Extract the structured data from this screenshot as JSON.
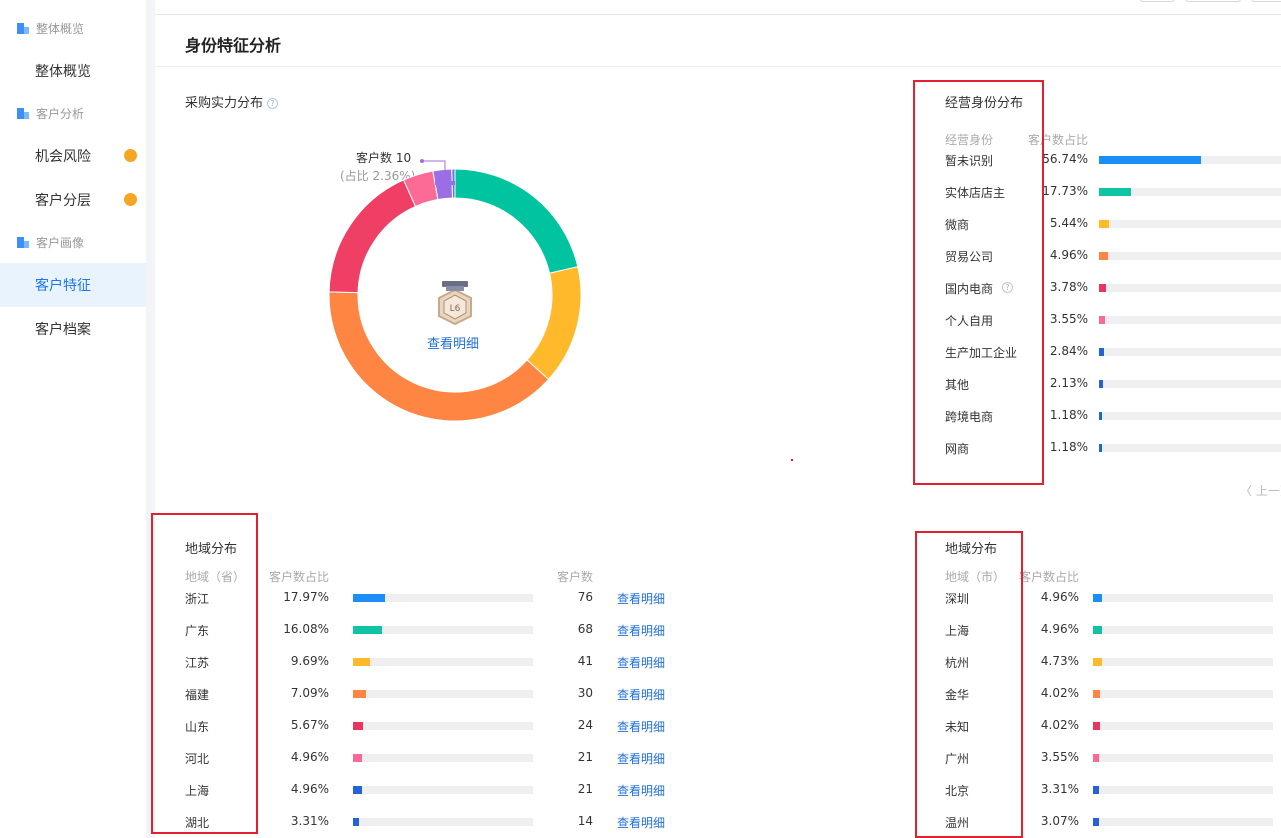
{
  "sidebar": {
    "groups": [
      {
        "label": "整体概览",
        "items": [
          {
            "label": "整体概览",
            "dot": false,
            "active": false
          }
        ]
      },
      {
        "label": "客户分析",
        "items": [
          {
            "label": "机会风险",
            "dot": true,
            "active": false
          },
          {
            "label": "客户分层",
            "dot": true,
            "active": false
          }
        ]
      },
      {
        "label": "客户画像",
        "items": [
          {
            "label": "客户特征",
            "dot": false,
            "active": true
          },
          {
            "label": "客户档案",
            "dot": false,
            "active": false
          }
        ]
      }
    ]
  },
  "page": {
    "title": "身份特征分析"
  },
  "purchase_power": {
    "title": "采购实力分布",
    "callout_count": "客户数 10",
    "callout_ratio": "(占比 2.36%)",
    "level_badge": "L6",
    "view_detail": "查看明细"
  },
  "chart_data": {
    "type": "pie",
    "title": "采购实力分布",
    "slices": [
      {
        "value": 21.0,
        "color": "#00c4a0"
      },
      {
        "value": 15.0,
        "color": "#ffb92a"
      },
      {
        "value": 38.0,
        "color": "#ff8543"
      },
      {
        "value": 17.6,
        "color": "#f03f64"
      },
      {
        "value": 3.8,
        "color": "#fc6a96"
      },
      {
        "value": 2.36,
        "color": "#9b6ee6"
      },
      {
        "value": 0.4,
        "color": "#5b7fdb"
      }
    ],
    "legend": "none"
  },
  "business_identity": {
    "title": "经营身份分布",
    "col_name": "经营身份",
    "col_pct": "客户数占比",
    "rows": [
      {
        "name": "暂未识别",
        "pct": "56.74%",
        "ratio": 0.5674,
        "color": "#1b8ef7",
        "help": false
      },
      {
        "name": "实体店店主",
        "pct": "17.73%",
        "ratio": 0.1773,
        "color": "#0ec4a2",
        "help": false
      },
      {
        "name": "微商",
        "pct": "5.44%",
        "ratio": 0.0544,
        "color": "#ffb92a",
        "help": false
      },
      {
        "name": "贸易公司",
        "pct": "4.96%",
        "ratio": 0.0496,
        "color": "#ff8543",
        "help": false
      },
      {
        "name": "国内电商",
        "pct": "3.78%",
        "ratio": 0.0378,
        "color": "#e8375b",
        "help": true
      },
      {
        "name": "个人自用",
        "pct": "3.55%",
        "ratio": 0.0355,
        "color": "#f86a96",
        "help": false
      },
      {
        "name": "生产加工企业",
        "pct": "2.84%",
        "ratio": 0.0284,
        "color": "#2264d6",
        "help": false
      },
      {
        "name": "其他",
        "pct": "2.13%",
        "ratio": 0.0213,
        "color": "#2264d6",
        "help": false
      },
      {
        "name": "跨境电商",
        "pct": "1.18%",
        "ratio": 0.0118,
        "color": "#2264d6",
        "help": false
      },
      {
        "name": "网商",
        "pct": "1.18%",
        "ratio": 0.0118,
        "color": "#2264d6",
        "help": false
      }
    ],
    "pager_prev": "〈 上一页"
  },
  "region_province": {
    "title": "地域分布",
    "col_name": "地域（省）",
    "col_pct": "客户数占比",
    "col_count": "客户数",
    "rows": [
      {
        "name": "浙江",
        "pct": "17.97%",
        "ratio": 0.1797,
        "count": "76",
        "link": "查看明细",
        "color": "#1b8ef7"
      },
      {
        "name": "广东",
        "pct": "16.08%",
        "ratio": 0.1608,
        "count": "68",
        "link": "查看明细",
        "color": "#0ec4a2"
      },
      {
        "name": "江苏",
        "pct": "9.69%",
        "ratio": 0.0969,
        "count": "41",
        "link": "查看明细",
        "color": "#ffb92a"
      },
      {
        "name": "福建",
        "pct": "7.09%",
        "ratio": 0.0709,
        "count": "30",
        "link": "查看明细",
        "color": "#ff8543"
      },
      {
        "name": "山东",
        "pct": "5.67%",
        "ratio": 0.0567,
        "count": "24",
        "link": "查看明细",
        "color": "#e8375b"
      },
      {
        "name": "河北",
        "pct": "4.96%",
        "ratio": 0.0496,
        "count": "21",
        "link": "查看明细",
        "color": "#f86a96"
      },
      {
        "name": "上海",
        "pct": "4.96%",
        "ratio": 0.0496,
        "count": "21",
        "link": "查看明细",
        "color": "#2264d6"
      },
      {
        "name": "湖北",
        "pct": "3.31%",
        "ratio": 0.0331,
        "count": "14",
        "link": "查看明细",
        "color": "#2264d6"
      }
    ]
  },
  "region_city": {
    "title": "地域分布",
    "col_name": "地域（市）",
    "col_pct": "客户数占比",
    "rows": [
      {
        "name": "深圳",
        "pct": "4.96%",
        "ratio": 0.0496,
        "color": "#1b8ef7"
      },
      {
        "name": "上海",
        "pct": "4.96%",
        "ratio": 0.0496,
        "color": "#0ec4a2"
      },
      {
        "name": "杭州",
        "pct": "4.73%",
        "ratio": 0.0473,
        "color": "#ffb92a"
      },
      {
        "name": "金华",
        "pct": "4.02%",
        "ratio": 0.0402,
        "color": "#ff8543"
      },
      {
        "name": "未知",
        "pct": "4.02%",
        "ratio": 0.0402,
        "color": "#e8375b"
      },
      {
        "name": "广州",
        "pct": "3.55%",
        "ratio": 0.0355,
        "color": "#f86a96"
      },
      {
        "name": "北京",
        "pct": "3.31%",
        "ratio": 0.0331,
        "color": "#2264d6"
      },
      {
        "name": "温州",
        "pct": "3.07%",
        "ratio": 0.0307,
        "color": "#2264d6"
      }
    ]
  }
}
